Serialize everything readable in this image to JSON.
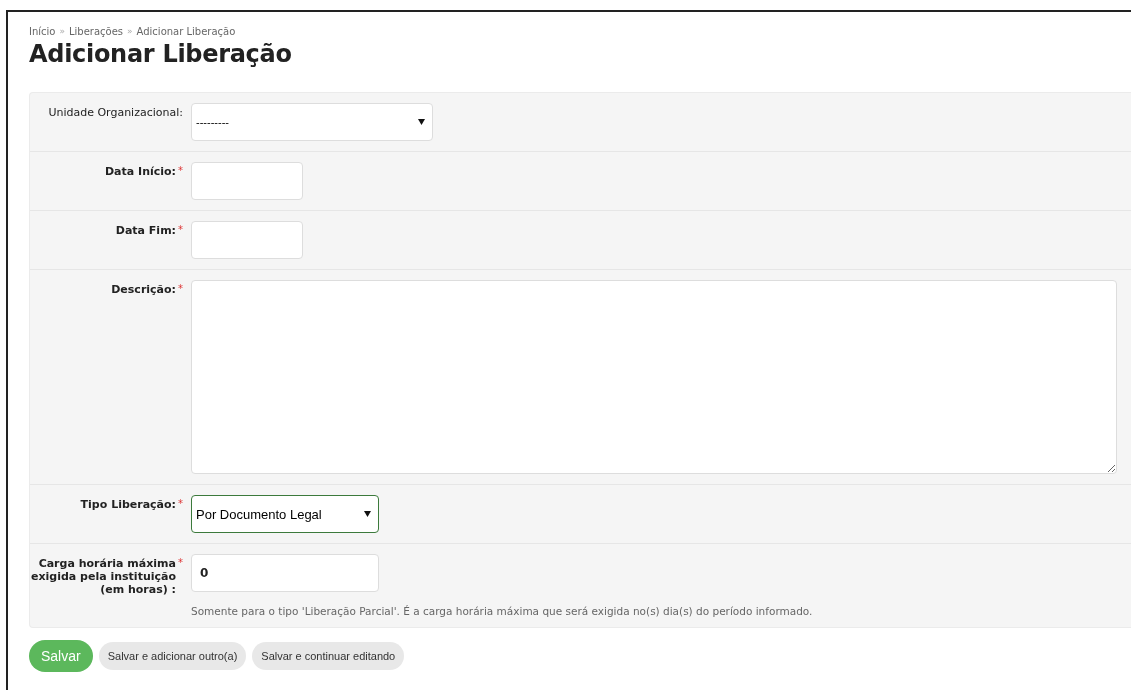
{
  "breadcrumb": {
    "separator": "»",
    "items": [
      "Início",
      "Liberações",
      "Adicionar Liberação"
    ]
  },
  "title": "Adicionar Liberação",
  "form": {
    "fields": [
      {
        "kind": "select",
        "label": "Unidade Organizacional:",
        "required": false,
        "value": "---------",
        "focused": false
      },
      {
        "kind": "text",
        "label": "Data Início:",
        "required": true,
        "focused": false
      },
      {
        "kind": "text",
        "label": "Data Fim:",
        "required": true,
        "focused": false
      },
      {
        "kind": "textarea",
        "label": "Descrição:",
        "required": true,
        "focused": false
      },
      {
        "kind": "select",
        "label": "Tipo Liberação:",
        "required": true,
        "value": "Por Documento Legal",
        "focused": true
      },
      {
        "kind": "text",
        "label": "Carga horária máxima exigida pela instituição (em horas) :",
        "required": true,
        "value": "0",
        "focused": false,
        "help": "Somente para o tipo 'Liberação Parcial'. É a carga horária máxima que será exigida no(s) dia(s) do período informado."
      }
    ],
    "required_mark": "*"
  },
  "buttons": [
    {
      "label": "Salvar",
      "primary": true
    },
    {
      "label": "Salvar e adicionar outro(a)",
      "primary": false
    },
    {
      "label": "Salvar e continuar editando",
      "primary": false
    }
  ]
}
